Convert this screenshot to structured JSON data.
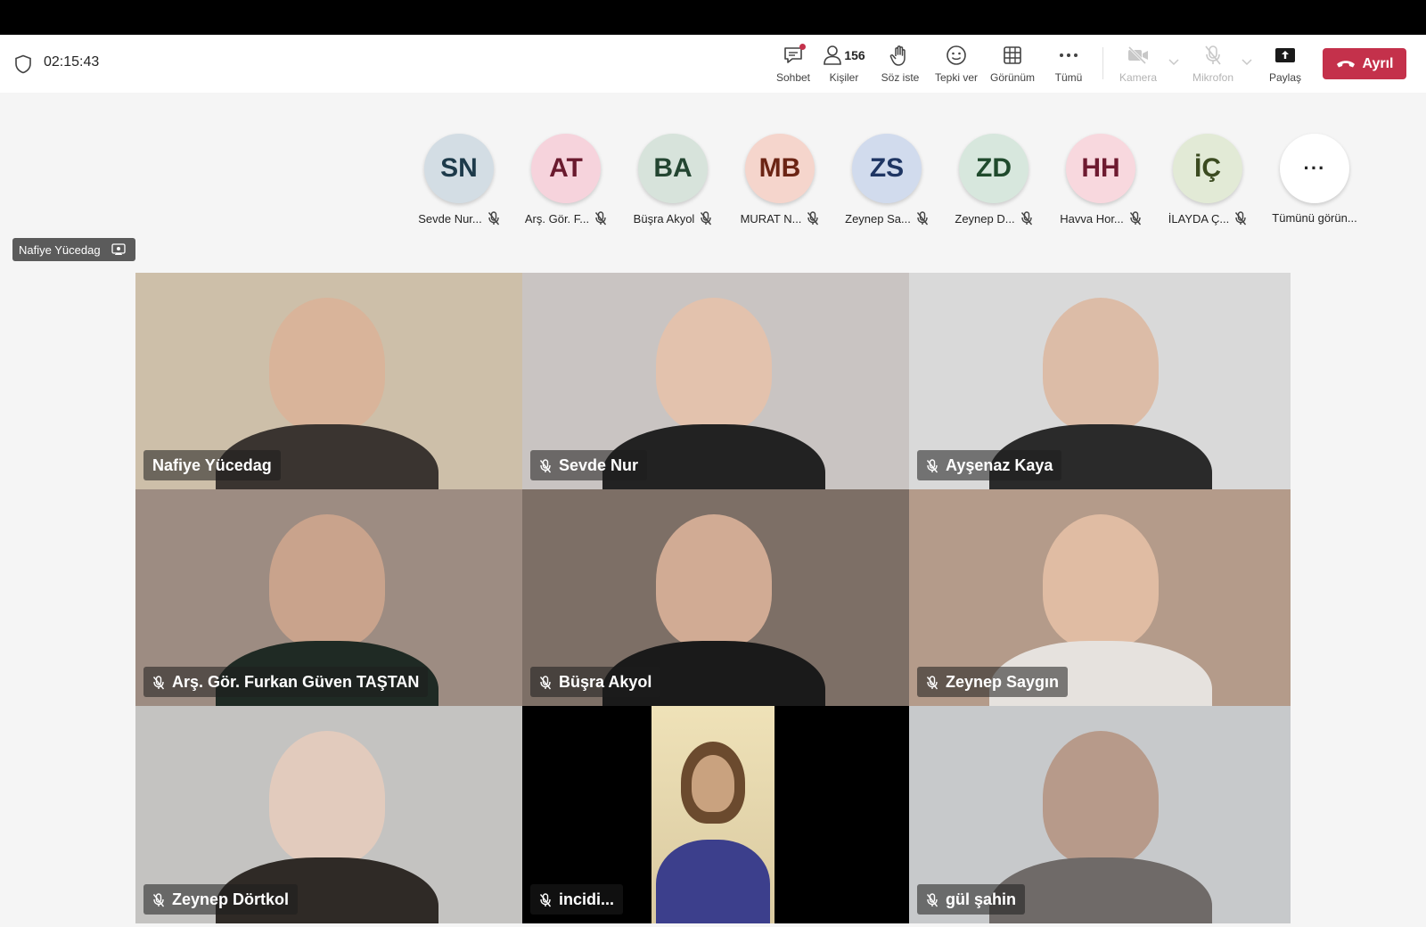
{
  "meeting": {
    "timer": "02:15:43"
  },
  "toolbar": {
    "chat_label": "Sohbet",
    "people_label": "Kişiler",
    "people_count": "156",
    "raise_hand_label": "Söz iste",
    "react_label": "Tepki ver",
    "view_label": "Görünüm",
    "more_label": "Tümü",
    "camera_label": "Kamera",
    "mic_label": "Mikrofon",
    "share_label": "Paylaş",
    "leave_label": "Ayrıl",
    "leave_color": "#c4314b"
  },
  "participants": [
    {
      "initials": "SN",
      "name": "Sevde Nur...",
      "bg": "#d3dde4",
      "fg": "#1d3a4a"
    },
    {
      "initials": "AT",
      "name": "Arş. Gör. F...",
      "bg": "#f6d3dc",
      "fg": "#6a1a2e"
    },
    {
      "initials": "BA",
      "name": "Büşra Akyol",
      "bg": "#d7e3db",
      "fg": "#234531"
    },
    {
      "initials": "MB",
      "name": "MURAT N...",
      "bg": "#f5d5cc",
      "fg": "#6b2414"
    },
    {
      "initials": "ZS",
      "name": "Zeynep Sa...",
      "bg": "#d1dbed",
      "fg": "#1e3563"
    },
    {
      "initials": "ZD",
      "name": "Zeynep D...",
      "bg": "#d7e7dd",
      "fg": "#1f4a2c"
    },
    {
      "initials": "HH",
      "name": "Havva Hor...",
      "bg": "#f8d8de",
      "fg": "#6e1a30"
    },
    {
      "initials": "İÇ",
      "name": "İLAYDA Ç...",
      "bg": "#e2ead6",
      "fg": "#3b4b20"
    }
  ],
  "see_all_label": "Tümünü görün...",
  "presenter": {
    "name": "Nafiye Yücedag"
  },
  "video_tiles": [
    {
      "name": "Nafiye Yücedag",
      "muted": false,
      "bg": "#cdbfa9",
      "skin": "#d9b49a",
      "shirt": "#3a3430"
    },
    {
      "name": "Sevde Nur",
      "muted": true,
      "bg": "#c9c4c2",
      "skin": "#e3c2ad",
      "shirt": "#222222"
    },
    {
      "name": "Ayşenaz Kaya",
      "muted": true,
      "bg": "#d9d9d9",
      "skin": "#dcbca7",
      "shirt": "#2a2a2a"
    },
    {
      "name": "Arş. Gör. Furkan Güven TAŞTAN",
      "muted": true,
      "bg": "#9d8c82",
      "skin": "#c9a38c",
      "shirt": "#1f2a24"
    },
    {
      "name": "Büşra Akyol",
      "muted": true,
      "bg": "#7d6f66",
      "skin": "#d1ab94",
      "shirt": "#1a1a1a"
    },
    {
      "name": "Zeynep Saygın",
      "muted": true,
      "bg": "#b49b8a",
      "skin": "#e0bca3",
      "shirt": "#e6e2de"
    },
    {
      "name": "Zeynep Dörtkol",
      "muted": true,
      "bg": "#c4c3c1",
      "skin": "#e2cbbd",
      "shirt": "#2f2a26"
    },
    {
      "name": "incidi...",
      "muted": true,
      "bg": "#000000",
      "skin": "#c9a27f",
      "shirt": "#3c3f8c"
    },
    {
      "name": "gül şahin",
      "muted": true,
      "bg": "#c7c9cb",
      "skin": "#b79a8a",
      "shirt": "#6f6a68"
    }
  ]
}
